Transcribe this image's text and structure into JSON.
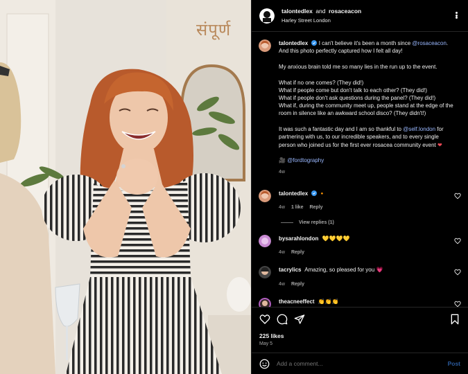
{
  "photo": {
    "wall_text": "संपूर्ण",
    "alt": "Woman with red hair in striped dress smiling with clasped hands"
  },
  "header": {
    "user": "talontedlex",
    "and": "and",
    "collab": "rosaceacon",
    "location": "Harley Street London"
  },
  "caption": {
    "user": "talontedlex",
    "p1_a": "I can't believe it's been a month since",
    "p1_link": "@rosaceacon",
    "p1_b": ". And this photo perfectly captured how I felt all day!",
    "p2": "My anxious brain told me so many lies in the run up to the event.",
    "p3_l1": "What if no one comes? (They did!)",
    "p3_l2": "What if people come but don't talk to each other? (They did!)",
    "p3_l3": "What if people don't ask questions during the panel? (They did!)",
    "p3_l4": "What if, during the community meet up, people stand at the edge of the room in silence like an awkward school disco? (They didn't!)",
    "p4_a": "It was such a fantastic day and I am so thankful to",
    "p4_link": "@self.london",
    "p4_b": "for partnering with us, to our incredible speakers, and to every single person who joined us for the first ever rosacea community event",
    "p4_heart": "❤",
    "credit_icon": "🎥",
    "credit": "@fordtography",
    "time": "4w"
  },
  "comments": [
    {
      "user": "talontedlex",
      "text": "",
      "emoji": "🔸",
      "time": "4w",
      "likes": "1 like",
      "reply": "Reply"
    },
    {
      "user": "bysarahlondon",
      "text": "",
      "emoji": "💛💛💛💛",
      "time": "4w",
      "reply": "Reply"
    },
    {
      "user": "tacrylics",
      "text": "Amazing, so pleased for you",
      "emoji": "💗",
      "time": "4w",
      "reply": "Reply"
    },
    {
      "user": "theacneeffect",
      "text": "",
      "emoji": "👏👏👏",
      "time": "",
      "reply": ""
    }
  ],
  "view_replies": "View replies (1)",
  "likes": "225 likes",
  "date": "May 5",
  "add_comment": {
    "placeholder": "Add a comment...",
    "post": "Post"
  },
  "colors": {
    "link": "#9ab8ff",
    "post_button": "#2b5a9c",
    "heart": "#ed4956",
    "verified": "#3897f0"
  }
}
